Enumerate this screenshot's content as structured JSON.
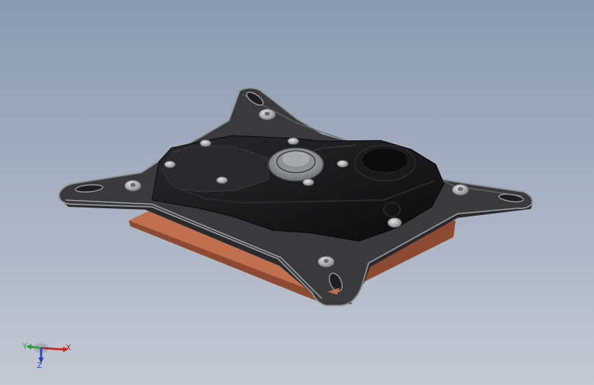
{
  "viewport": {
    "background_top": "#8b9bb0",
    "background_bottom": "#c4c9d3"
  },
  "model": {
    "name": "cpu-water-block",
    "colors": {
      "bracket": "#3a3a3c",
      "bracket_edge": "#8f9297",
      "body": "#0f0f10",
      "body_highlight": "#2a2a2c",
      "base_plate": "#c0704f",
      "base_plate_dark": "#8d4a33",
      "screw": "#b9bbbe",
      "fitting": "#9c9ea2"
    }
  },
  "triad": {
    "x_label": "X",
    "y_label": "Y",
    "z_label": "Z",
    "x_color": "#c0262a",
    "y_color": "#2ea043",
    "z_color": "#2a3fb8"
  }
}
